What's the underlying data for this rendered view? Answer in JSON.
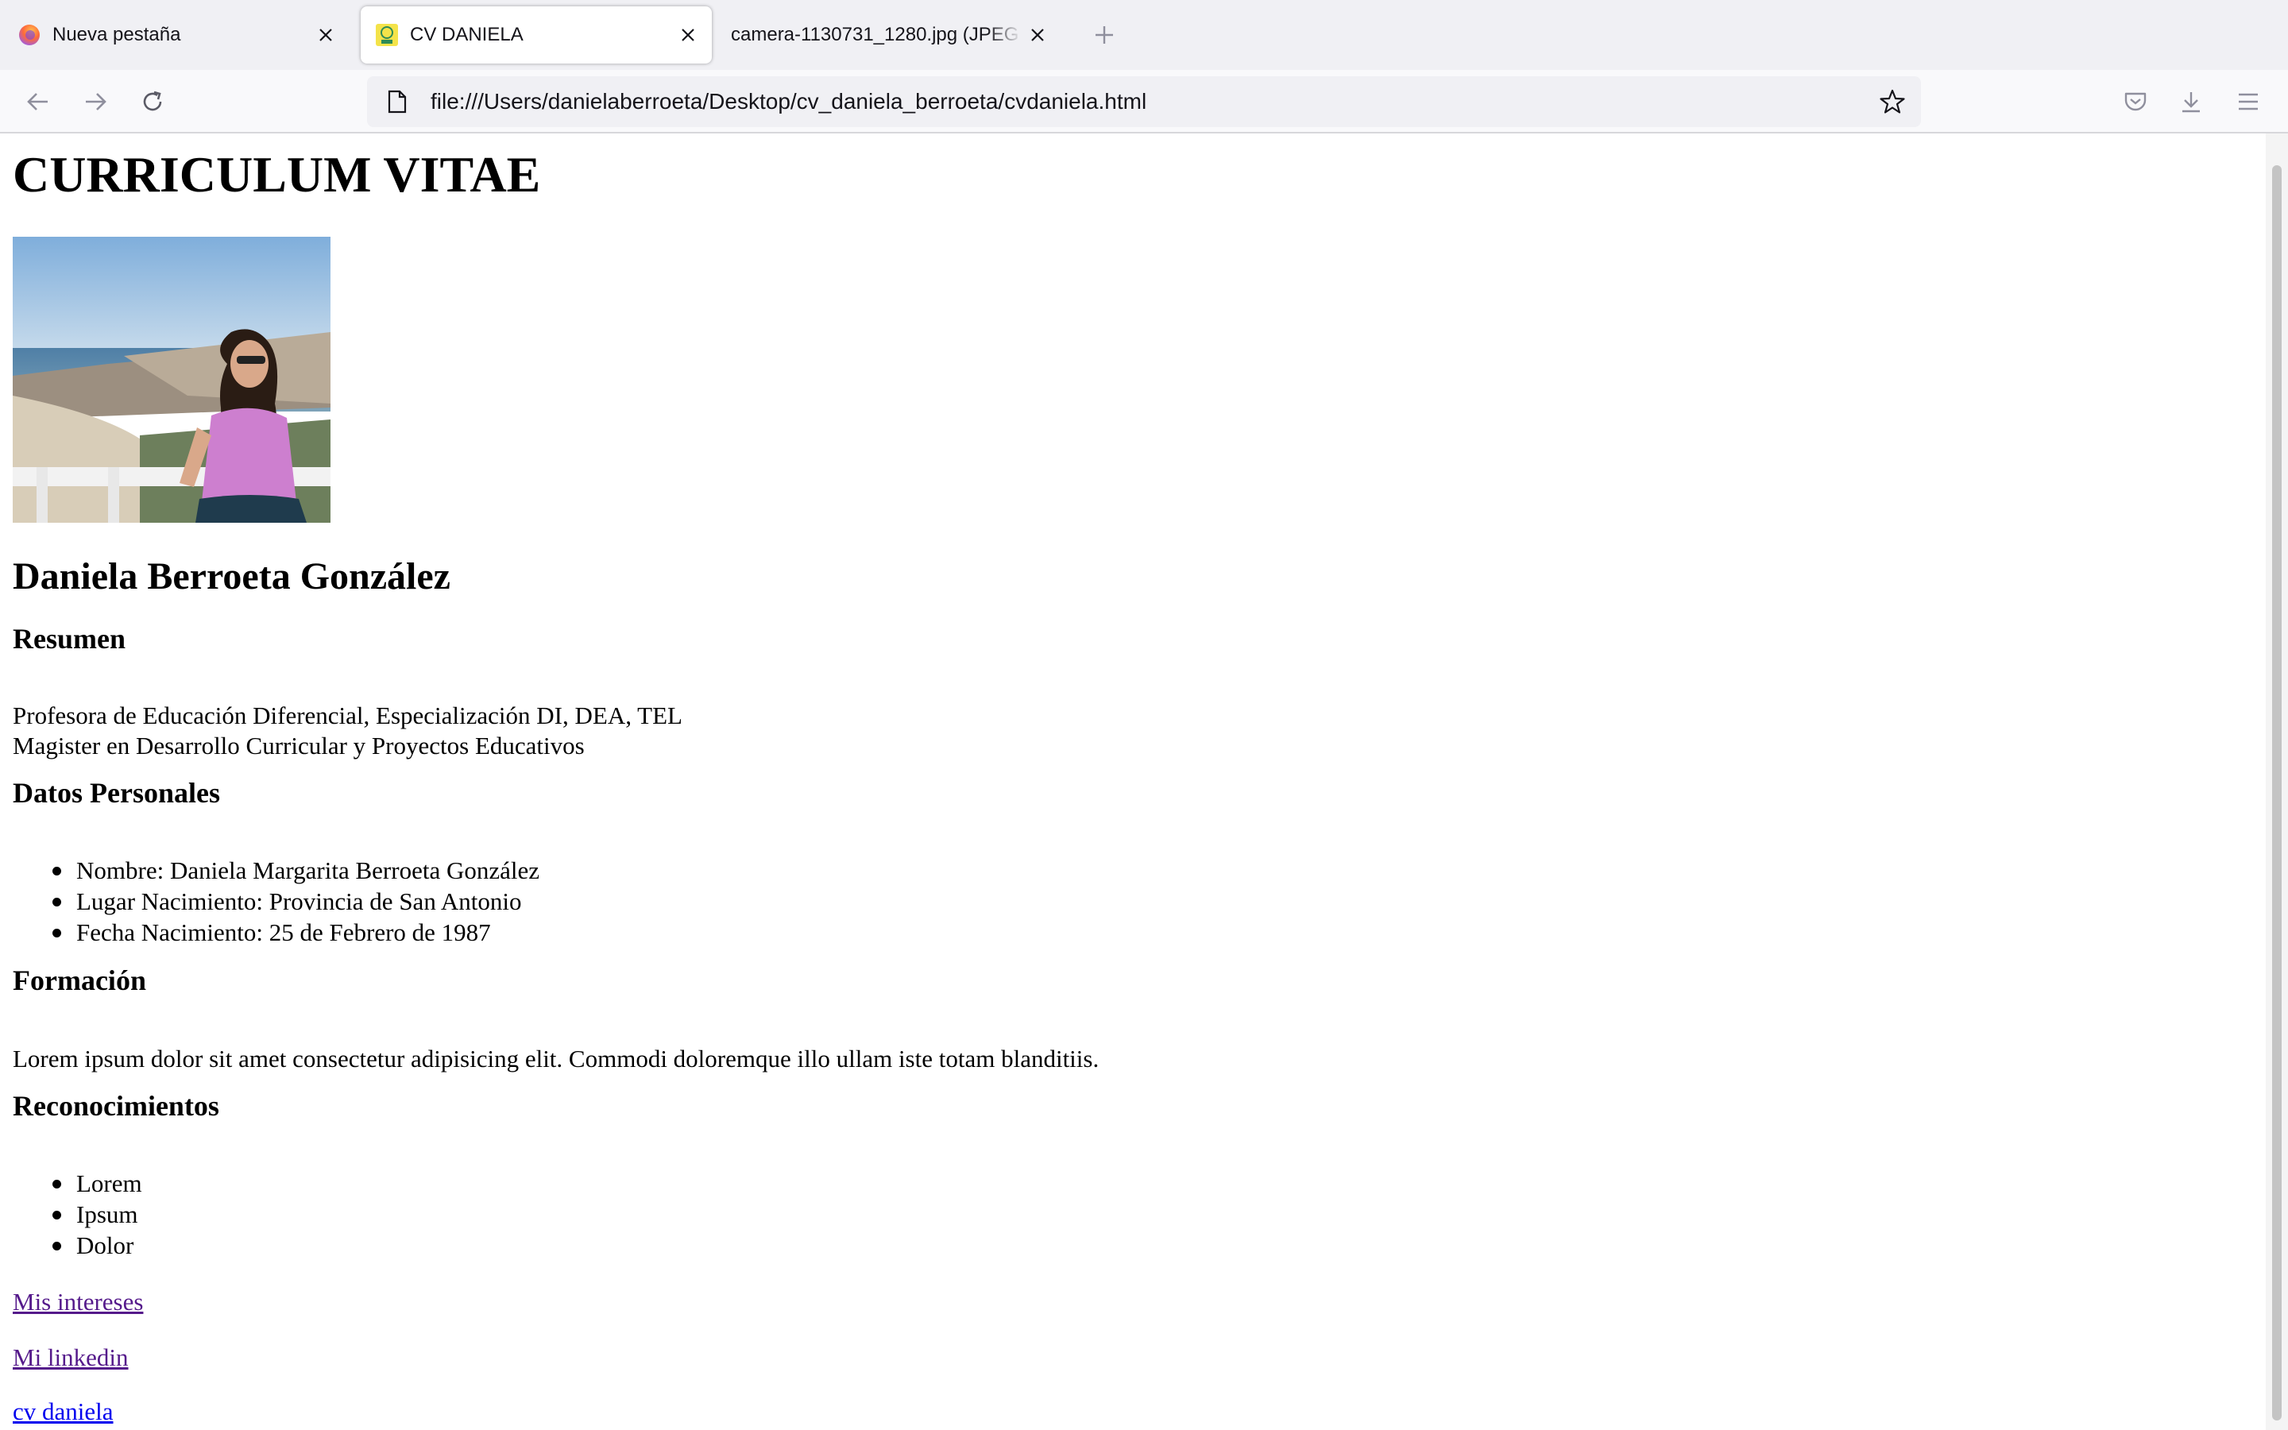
{
  "browser": {
    "tabs": [
      {
        "title": "Nueva pestaña",
        "active": false,
        "favicon": "firefox-icon"
      },
      {
        "title": "CV DANIELA",
        "active": true,
        "favicon": "cv-favicon-icon"
      },
      {
        "title": "camera-1130731_1280.jpg (JPEG Ima",
        "active": false,
        "favicon": "none"
      }
    ],
    "url": "file:///Users/danielaberroeta/Desktop/cv_daniela_berroeta/cvdaniela.html"
  },
  "page": {
    "title": "CURRICULUM VITAE",
    "name": "Daniela Berroeta González",
    "resumen": {
      "heading": "Resumen",
      "line1": "Profesora de Educación Diferencial, Especialización DI, DEA, TEL",
      "line2": "Magister en Desarrollo Curricular y Proyectos Educativos"
    },
    "datos": {
      "heading": "Datos Personales",
      "items": [
        "Nombre: Daniela Margarita Berroeta González",
        "Lugar Nacimiento: Provincia de San Antonio",
        "Fecha Nacimiento: 25 de Febrero de 1987"
      ]
    },
    "formacion": {
      "heading": "Formación",
      "text": "Lorem ipsum dolor sit amet consectetur adipisicing elit. Commodi doloremque illo ullam iste totam blanditiis."
    },
    "reconocimientos": {
      "heading": "Reconocimientos",
      "items": [
        "Lorem",
        "Ipsum",
        "Dolor"
      ]
    },
    "links": {
      "intereses": "Mis intereses",
      "linkedin": "Mi linkedin",
      "cv": "cv daniela"
    }
  },
  "colors": {
    "link_visited": "#551a8b",
    "link_unvisited": "#0000ee",
    "tabbar_bg": "#f0f0f4"
  }
}
